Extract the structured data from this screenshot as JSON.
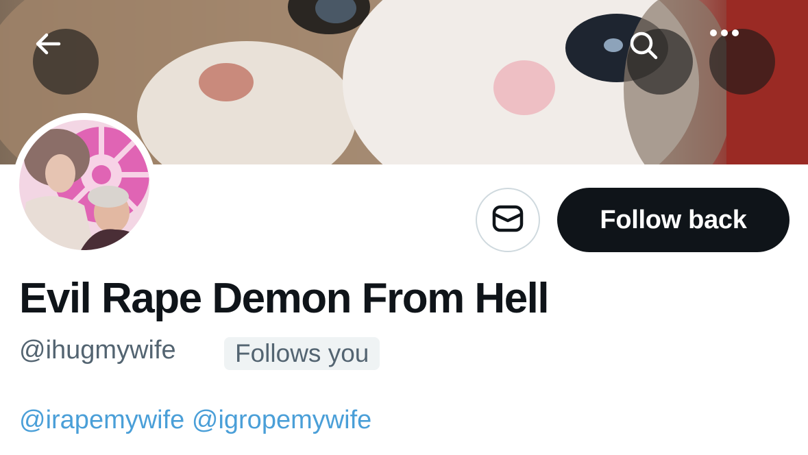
{
  "profile": {
    "display_name": "Evil Rape Demon From Hell",
    "handle": "@ihugmywife",
    "follows_you_badge": "Follows you",
    "bio_mentions": [
      "@irapemywife",
      "@igropemywife"
    ]
  },
  "actions": {
    "follow_back_label": "Follow back"
  },
  "icons": {
    "back": "arrow-left-icon",
    "search": "search-icon",
    "more": "more-horizontal-icon",
    "message": "envelope-icon"
  },
  "colors": {
    "follow_button_bg": "#0f1419",
    "mention": "#4a9fd8",
    "secondary_text": "#536471",
    "badge_bg": "#eff3f4"
  }
}
